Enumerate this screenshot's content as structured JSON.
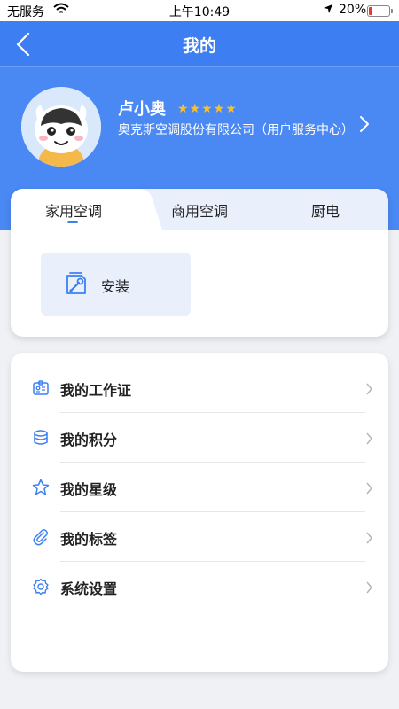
{
  "status_bar": {
    "carrier": "无服务",
    "time": "上午10:49",
    "battery_text": "20%",
    "battery_level": 0.2
  },
  "nav": {
    "title": "我的"
  },
  "profile": {
    "name": "卢小奥",
    "rating": 5,
    "stars": "★★★★★",
    "company": "奥克斯空调股份有限公司（用户服务中心）"
  },
  "categories": {
    "tabs": [
      {
        "label": "家用空调",
        "active": true
      },
      {
        "label": "商用空调",
        "active": false
      },
      {
        "label": "厨电",
        "active": false
      }
    ],
    "services": [
      {
        "label": "安装",
        "icon": "wrench-box-icon"
      }
    ]
  },
  "menu": {
    "items": [
      {
        "label": "我的工作证",
        "icon": "badge-icon"
      },
      {
        "label": "我的积分",
        "icon": "coins-icon"
      },
      {
        "label": "我的星级",
        "icon": "star-icon"
      },
      {
        "label": "我的标签",
        "icon": "paperclip-icon"
      },
      {
        "label": "系统设置",
        "icon": "gear-icon"
      }
    ]
  },
  "colors": {
    "primary": "#3d7ff2",
    "header_bg": "#4a88f3",
    "star": "#f6c12c",
    "tile_bg": "#e9f0fc",
    "battery_low": "#e23b30"
  }
}
